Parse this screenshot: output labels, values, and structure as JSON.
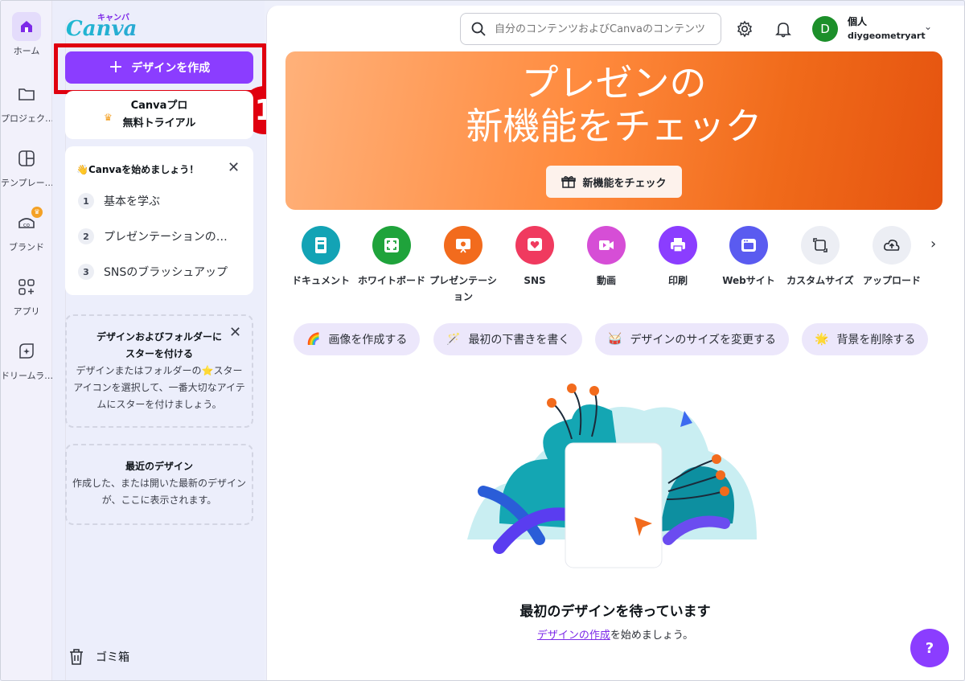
{
  "rail": {
    "items": [
      {
        "label": "ホーム"
      },
      {
        "label": "プロジェク…"
      },
      {
        "label": "テンプレー…"
      },
      {
        "label": "ブランド"
      },
      {
        "label": "アプリ"
      },
      {
        "label": "ドリームラ…"
      }
    ]
  },
  "logo": {
    "text": "Canva",
    "kana": "キャンバ"
  },
  "panel": {
    "create_label": "デザインを作成",
    "step_marker": "1",
    "pro_line1": "Canvaプロ",
    "pro_line2": "無料トライアル",
    "start": {
      "heading": "👋Canvaを始めましょう！",
      "items": [
        {
          "num": "1",
          "label": "基本を学ぶ"
        },
        {
          "num": "2",
          "label": "プレゼンテーションの…"
        },
        {
          "num": "3",
          "label": "SNSのブラッシュアップ"
        }
      ]
    },
    "star_tip": {
      "title": "デザインおよびフォルダーに\nスターを付ける",
      "body": "デザインまたはフォルダーの⭐スターアイコンを選択して、一番大切なアイテムにスターを付けましょう。"
    },
    "recent": {
      "title": "最近のデザイン",
      "body": "作成した、または開いた最新のデザインが、ここに表示されます。"
    },
    "trash_label": "ゴミ箱"
  },
  "header": {
    "search_placeholder": "自分のコンテンツおよびCanvaのコンテンツ",
    "avatar_letter": "D",
    "account_type": "個人",
    "account_name": "diygeometryart"
  },
  "hero": {
    "title_line1": "プレゼンの",
    "title_line2": "新機能をチェック",
    "button_label": "新機能をチェック"
  },
  "categories": [
    {
      "label": "ドキュメント",
      "color": "#13a3b5"
    },
    {
      "label": "ホワイトボード",
      "color": "#1fa33b"
    },
    {
      "label": "プレゼンテーション",
      "color": "#f26b1d"
    },
    {
      "label": "SNS",
      "color": "#f03a5f"
    },
    {
      "label": "動画",
      "color": "#d64ed6"
    },
    {
      "label": "印刷",
      "color": "#8b3dff"
    },
    {
      "label": "Webサイト",
      "color": "#5a5bf0"
    },
    {
      "label": "カスタムサイズ",
      "color": "#eceef4"
    },
    {
      "label": "アップロード",
      "color": "#eceef4"
    }
  ],
  "chips": [
    {
      "icon": "🌈",
      "label": "画像を作成する"
    },
    {
      "icon": "🪄",
      "label": "最初の下書きを書く"
    },
    {
      "icon": "🥁",
      "label": "デザインのサイズを変更する"
    },
    {
      "icon": "🌟",
      "label": "背景を削除する"
    }
  ],
  "empty": {
    "title": "最初のデザインを待っています",
    "link": "デザインの作成",
    "rest": "を始めましょう。"
  },
  "help_label": "?"
}
